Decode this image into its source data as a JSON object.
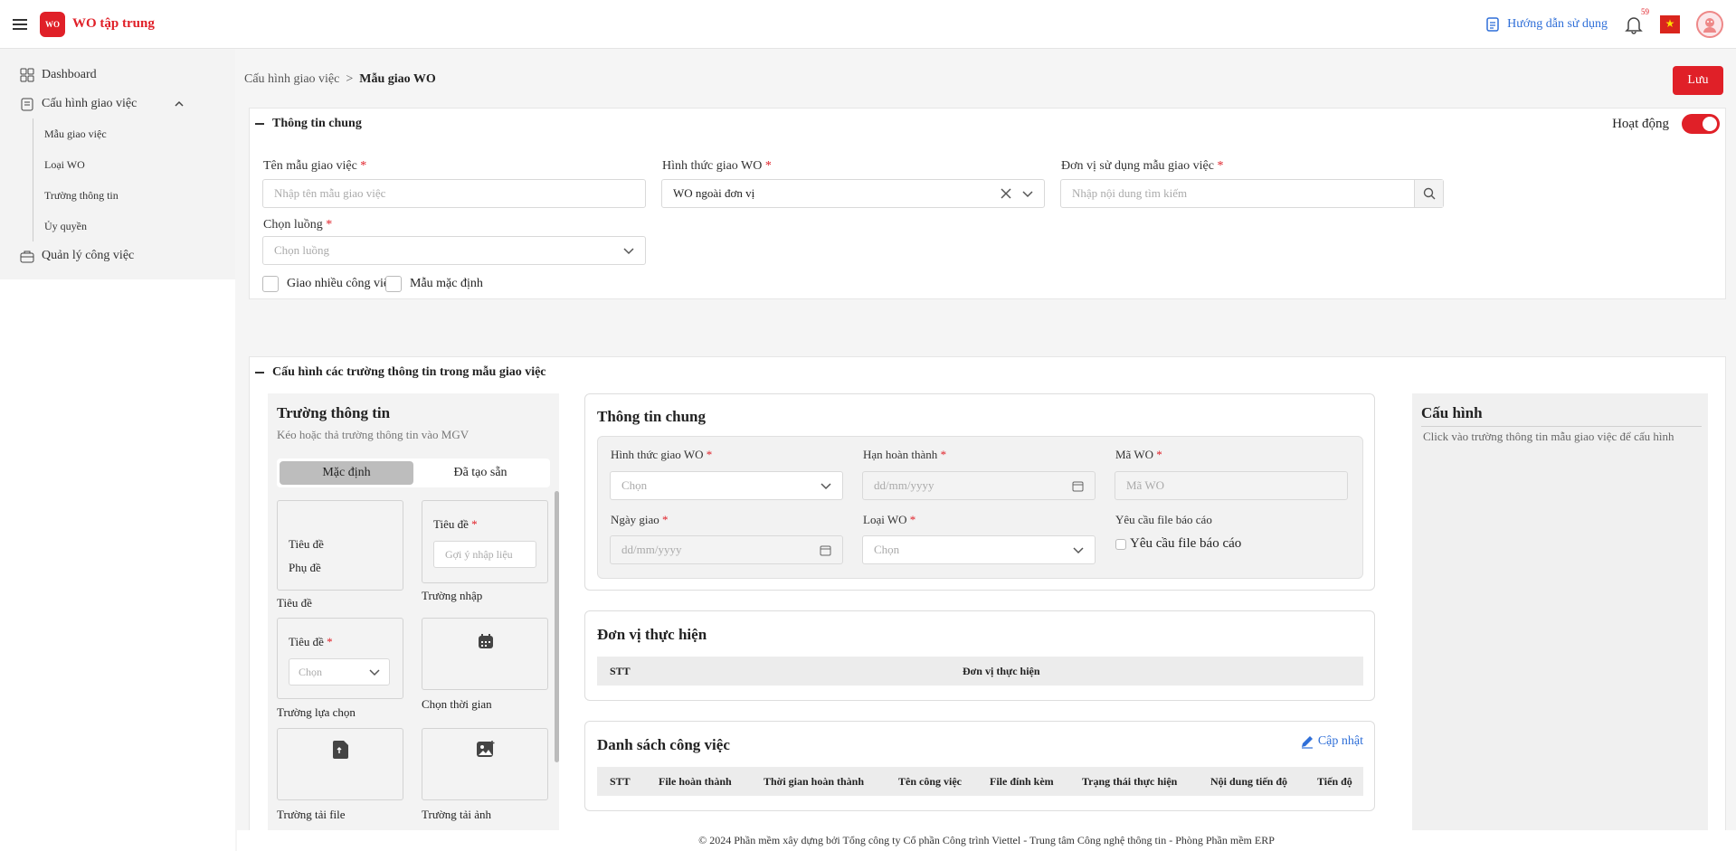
{
  "header": {
    "logo_text": "WO",
    "app_title": "WO tập trung",
    "guide_label": "Hướng dẫn sử dụng",
    "notification_count": "59",
    "flag": "★",
    "brand_color": "#e02028"
  },
  "sidebar": {
    "items": [
      {
        "label": "Dashboard"
      },
      {
        "label": "Cấu hình giao việc"
      },
      {
        "label": "Quản lý công việc"
      }
    ],
    "subitems": [
      {
        "label": "Mẫu giao việc"
      },
      {
        "label": "Loại WO"
      },
      {
        "label": "Trường thông tin"
      },
      {
        "label": "Ủy quyền"
      }
    ]
  },
  "breadcrumb": {
    "parent": "Cấu hình giao việc",
    "separator": ">",
    "current": "Mẫu giao WO"
  },
  "save_label": "Lưu",
  "general": {
    "title": "Thông tin chung",
    "status_label": "Hoạt động",
    "template_name": {
      "label": "Tên mẫu giao việc",
      "placeholder": "Nhập tên mẫu giao việc"
    },
    "wo_form": {
      "label": "Hình thức giao WO",
      "value": "WO ngoài đơn vị"
    },
    "unit": {
      "label": "Đơn vị sử dụng mẫu giao việc",
      "placeholder": "Nhập nội dung tìm kiếm"
    },
    "flow": {
      "label": "Chọn luồng",
      "placeholder": "Chọn luồng"
    },
    "multi_task": "Giao nhiều công việc",
    "default_template": "Mẫu mặc định",
    "required_mark": "*"
  },
  "config_section": {
    "title": "Cấu hình các trường thông tin trong mẫu giao việc"
  },
  "fields_panel": {
    "title": "Trường thông tin",
    "subtitle": "Kéo hoặc thả trường thông tin vào MGV",
    "tab_default": "Mặc định",
    "tab_trained": "Đã tạo sẵn",
    "tiles": {
      "title_tile": {
        "line1": "Tiêu đề",
        "line2": "Phụ đề",
        "caption": "Tiêu đề"
      },
      "input_tile": {
        "label": "Tiêu đề",
        "placeholder": "Gợi ý nhập liệu",
        "caption": "Trường nhập"
      },
      "select_tile": {
        "label": "Tiêu đề",
        "placeholder": "Chọn",
        "caption": "Trường lựa chọn"
      },
      "date_tile": {
        "caption": "Chọn thời gian"
      },
      "file_tile": {
        "caption": "Trường tải file"
      },
      "image_tile": {
        "caption": "Trường tải ảnh"
      }
    }
  },
  "preview": {
    "general": {
      "title": "Thông tin chung",
      "wo_form_label": "Hình thức giao WO",
      "wo_form_placeholder": "Chọn",
      "deadline_label": "Hạn hoàn thành",
      "deadline_placeholder": "dd/mm/yyyy",
      "wo_code_label": "Mã WO",
      "wo_code_placeholder": "Mã WO",
      "assign_date_label": "Ngày giao",
      "assign_date_placeholder": "dd/mm/yyyy",
      "wo_type_label": "Loại WO",
      "wo_type_placeholder": "Chọn",
      "report_file_label": "Yêu cầu file báo cáo",
      "report_file_check": "Yêu cầu file báo cáo"
    },
    "units": {
      "title": "Đơn vị thực hiện",
      "columns": [
        "STT",
        "Đơn vị thực hiện"
      ]
    },
    "tasks": {
      "title": "Danh sách công việc",
      "update_label": "Cập nhật",
      "columns": [
        "STT",
        "File hoàn thành",
        "Thời gian hoàn thành",
        "Tên công việc",
        "File đính kèm",
        "Trạng thái thực hiện",
        "Nội dung tiến độ",
        "Tiến độ"
      ]
    }
  },
  "config_panel": {
    "title": "Cấu hình",
    "hint": "Click vào trường thông tin mẫu giao việc để cấu hình"
  },
  "footer": "© 2024 Phần mềm xây dựng bởi Tổng công ty Cổ phần Công trình Viettel - Trung tâm Công nghệ thông tin - Phòng Phần mềm ERP"
}
